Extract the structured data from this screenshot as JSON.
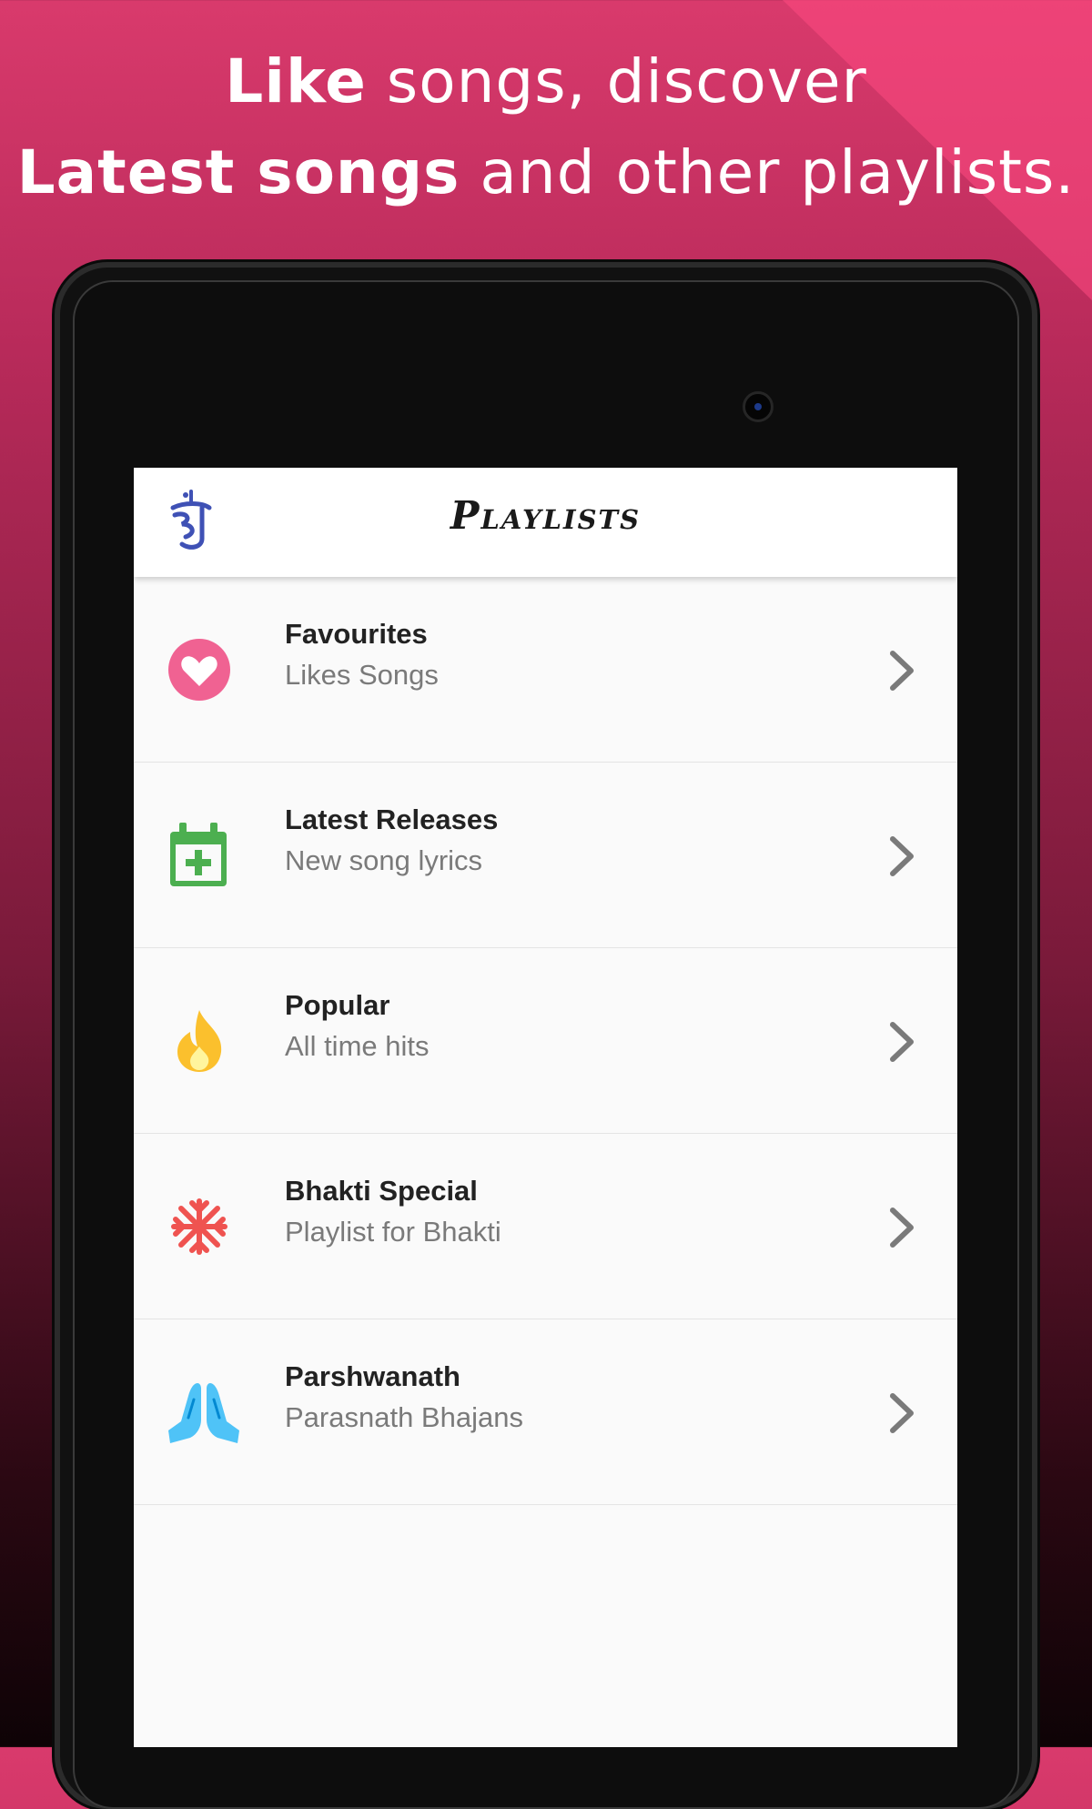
{
  "headline": {
    "line1_bold": "Like",
    "line1_rest": " songs, discover",
    "line2_bold": "Latest songs",
    "line2_rest": " and other playlists."
  },
  "appbar": {
    "title": "Playlists",
    "logo_icon": "jain-om-logo-icon"
  },
  "playlists": [
    {
      "name": "Favourites",
      "subtitle": "Likes Songs",
      "icon": "heart-icon",
      "color": "#f06292"
    },
    {
      "name": "Latest Releases",
      "subtitle": "New song lyrics",
      "icon": "calendar-add-icon",
      "color": "#4caf50"
    },
    {
      "name": "Popular",
      "subtitle": "All time hits",
      "icon": "flame-icon",
      "color": "#fbc02d"
    },
    {
      "name": "Bhakti Special",
      "subtitle": "Playlist for Bhakti",
      "icon": "snowflake-icon",
      "color": "#ef5350"
    },
    {
      "name": "Parshwanath",
      "subtitle": "Parasnath Bhajans",
      "icon": "praying-hands-icon",
      "color": "#4fc3f7"
    }
  ],
  "colors": {
    "background_top": "#d93a6c",
    "background_bottom": "#0e0306",
    "chevron": "#7a7a7a"
  }
}
